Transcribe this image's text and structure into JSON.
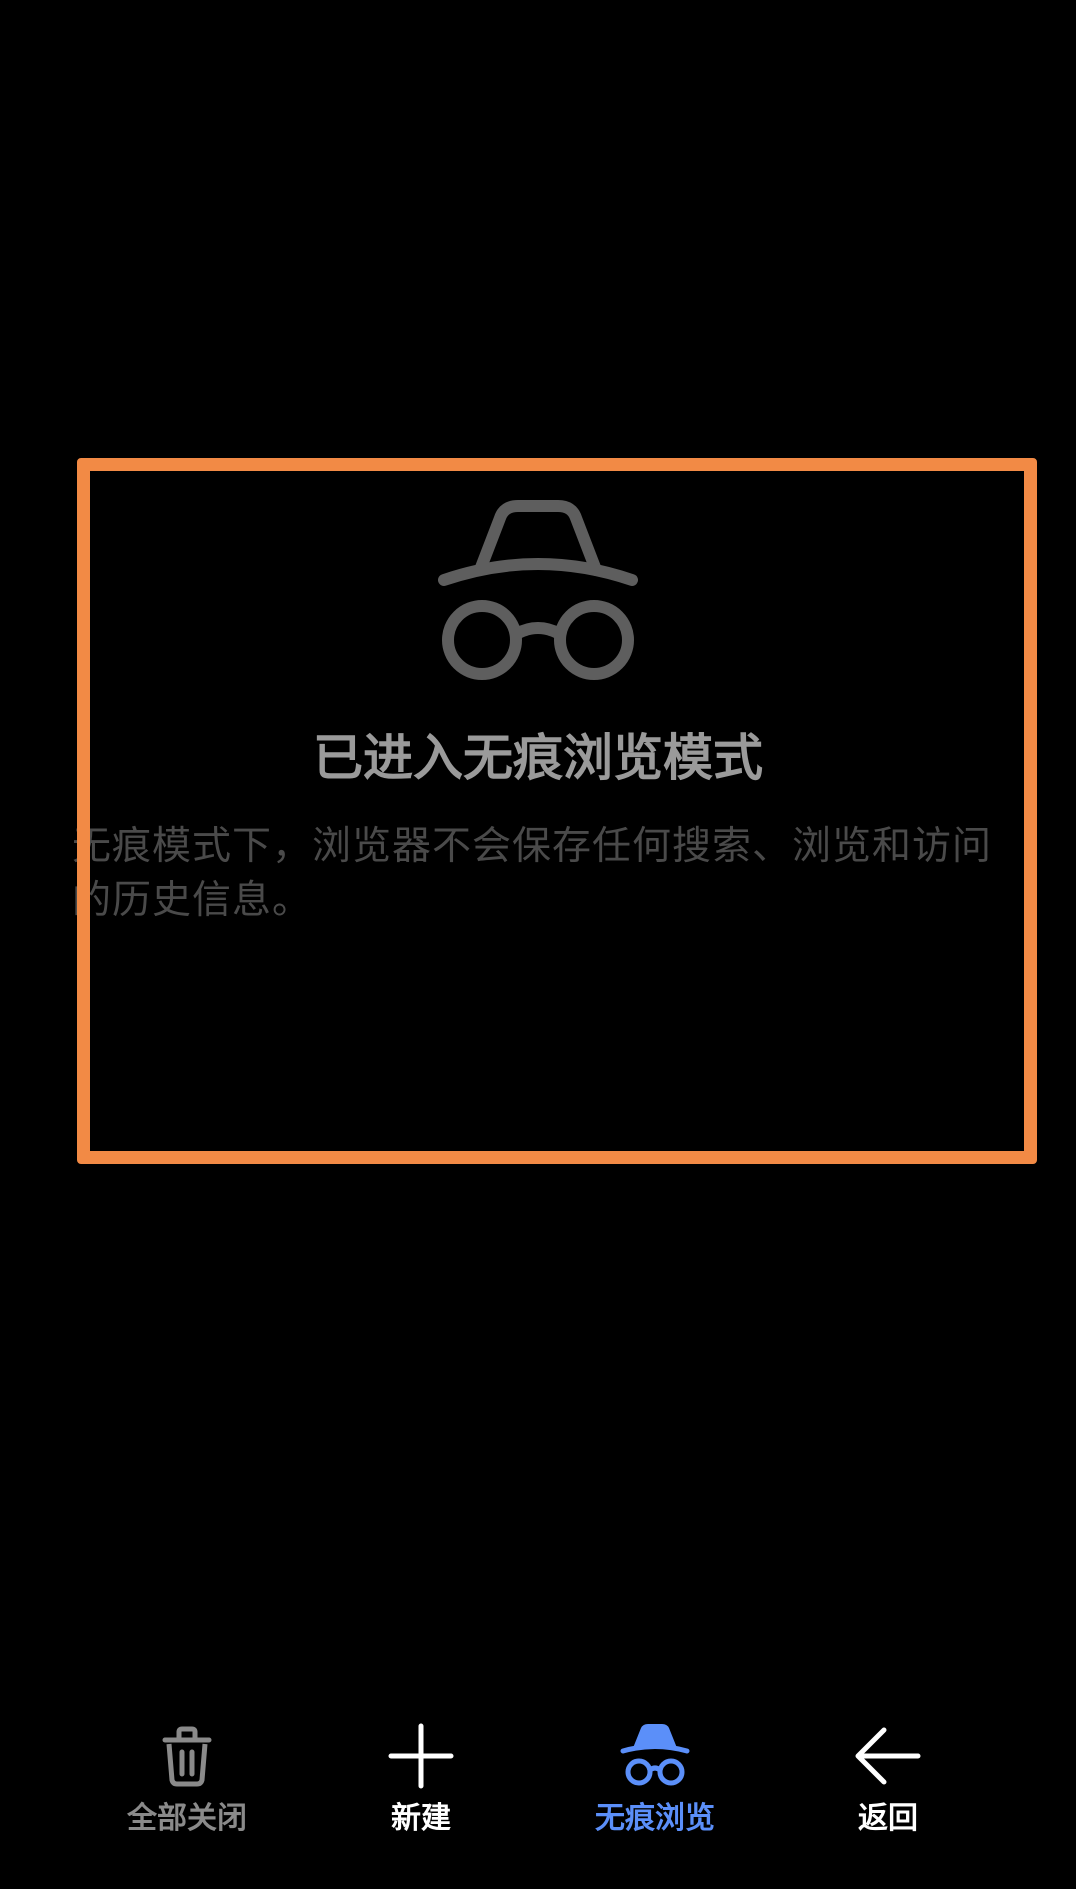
{
  "incognito": {
    "title": "已进入无痕浏览模式",
    "description": "无痕模式下，浏览器不会保存任何搜索、浏览和访问的历史信息。",
    "icon": "incognito-icon"
  },
  "toolbar": {
    "items": [
      {
        "label": "全部关闭",
        "icon": "trash-icon",
        "color": "#8a8a8a"
      },
      {
        "label": "新建",
        "icon": "plus-icon",
        "color": "#ffffff"
      },
      {
        "label": "无痕浏览",
        "icon": "incognito-icon",
        "color": "#5b8ff9",
        "active": true
      },
      {
        "label": "返回",
        "icon": "arrow-left-icon",
        "color": "#ffffff"
      }
    ]
  },
  "colors": {
    "background": "#000000",
    "highlight": "#f28a45",
    "accent": "#5b8ff9",
    "title_text": "#9a9a9a",
    "desc_text": "#4a4a4a"
  }
}
